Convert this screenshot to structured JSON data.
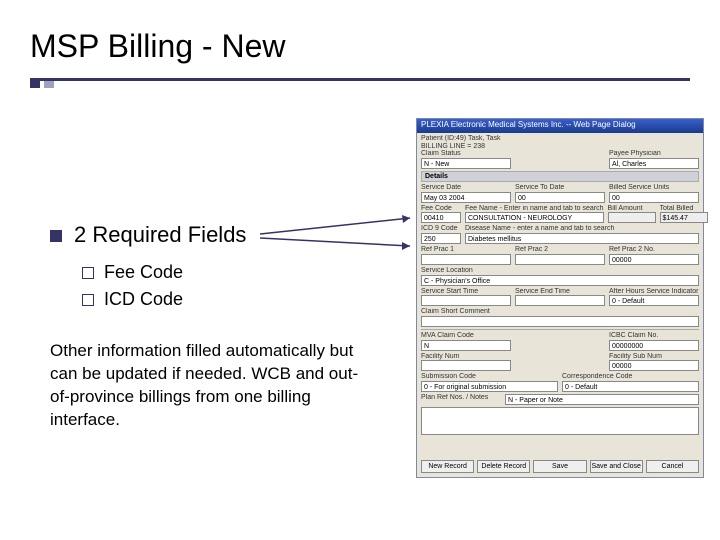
{
  "slide": {
    "title": "MSP Billing - New",
    "heading": "2 Required Fields",
    "subItems": [
      "Fee Code",
      "ICD Code"
    ],
    "bodyText": "Other information filled automatically but can be updated if needed. WCB and out-of-province billings from one billing interface."
  },
  "dialog": {
    "windowTitle": "PLEXIA Electronic Medical Systems Inc. -- Web Page Dialog",
    "patientLine": "Patient (ID:49)  Task, Task",
    "billingLine": "BILLING LINE = 238",
    "claimStatus": {
      "label": "Claim Status",
      "value": "N - New"
    },
    "payee": {
      "label": "Payee Physician",
      "value": "Al, Charles"
    },
    "detailsHeader": "Details",
    "serviceDate": {
      "label": "Service Date",
      "value": "May 03 2004"
    },
    "serviceToDate": {
      "label": "Service To Date",
      "value": "00"
    },
    "serviceUnits": {
      "label": "Billed Service Units",
      "value": "00"
    },
    "feeCode": {
      "label": "Fee Code",
      "hint": "Fee Name - Enter in name and tab to search",
      "value": "00410",
      "name": "CONSULTATION - NEUROLOGY"
    },
    "billAmount": {
      "label": "Bill Amount",
      "value": ""
    },
    "totalBilled": {
      "label": "Total Billed",
      "value": "$145.47"
    },
    "icd": {
      "label": "ICD 9 Code",
      "hint": "Disease Name - enter a name and tab to search",
      "value": "250",
      "name": "Diabetes mellitus"
    },
    "refPrac1": {
      "label": "Ref Prac 1",
      "value": ""
    },
    "refPrac2": {
      "label": "Ref Prac 2",
      "value": ""
    },
    "refPrac2No": {
      "label": "Ref Prac 2 No.",
      "value": "00000"
    },
    "serviceLocation": {
      "label": "Service Location",
      "value": "C - Physician's Office"
    },
    "timeFields": {
      "label1": "Service Start Time",
      "label2": "Service End Time",
      "label3": "After Hours Service Indicator",
      "value3": "0 - Default"
    },
    "shortComment": {
      "label": "Claim Short Comment",
      "value": ""
    },
    "mvaClaim": {
      "label": "MVA Claim Code",
      "value": "N"
    },
    "icbcNo": {
      "label": "ICBC Claim No.",
      "value": "00000000"
    },
    "facilityNo": {
      "label": "Facility Num",
      "value": ""
    },
    "facilitySub": {
      "label": "Facility Sub Num",
      "value": "00000"
    },
    "submission": {
      "label": "Submission Code",
      "value": "0 - For original submission"
    },
    "corr": {
      "label": "Correspondence Code",
      "value": "0 - Default"
    },
    "noteLabel": "Plan Ref Nos. / Notes",
    "noteTypeValue": "N - Paper or Note",
    "buttons": [
      "New Record",
      "Delete Record",
      "Save",
      "Save and Close",
      "Cancel"
    ]
  }
}
